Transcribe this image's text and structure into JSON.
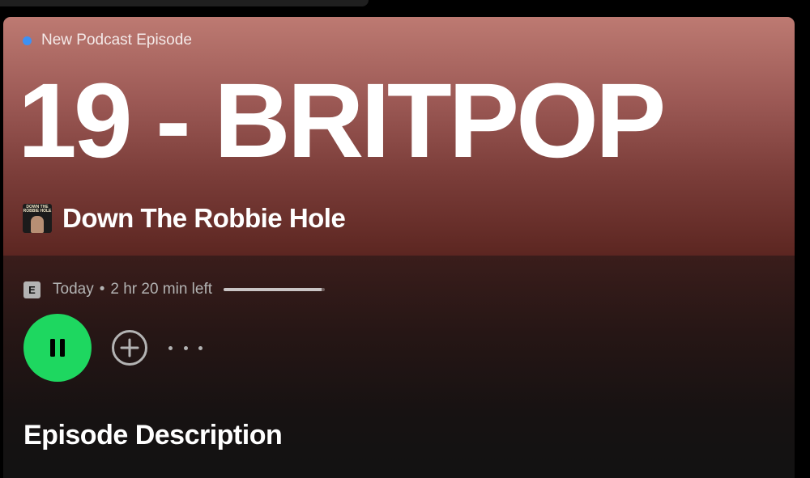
{
  "episode": {
    "type_label": "New Podcast Episode",
    "title": "19 - BRITPOP",
    "show_name": "Down The Robbie Hole",
    "show_cover_text": "DOWN THE ROBBIE HOLE",
    "explicit_badge": "E",
    "release": "Today",
    "separator": "•",
    "time_left": "2 hr 20 min left",
    "progress_fraction": 0.97
  },
  "controls": {
    "play_state": "pause-icon",
    "add_icon": "add-circle-icon",
    "more_icon": "more-options-icon"
  },
  "section": {
    "description_heading": "Episode Description"
  },
  "colors": {
    "accent_green": "#1ed760",
    "new_dot_blue": "#3d91f4",
    "hero_top": "#bd7a72",
    "hero_bottom": "#5c2621",
    "background": "#121212"
  }
}
